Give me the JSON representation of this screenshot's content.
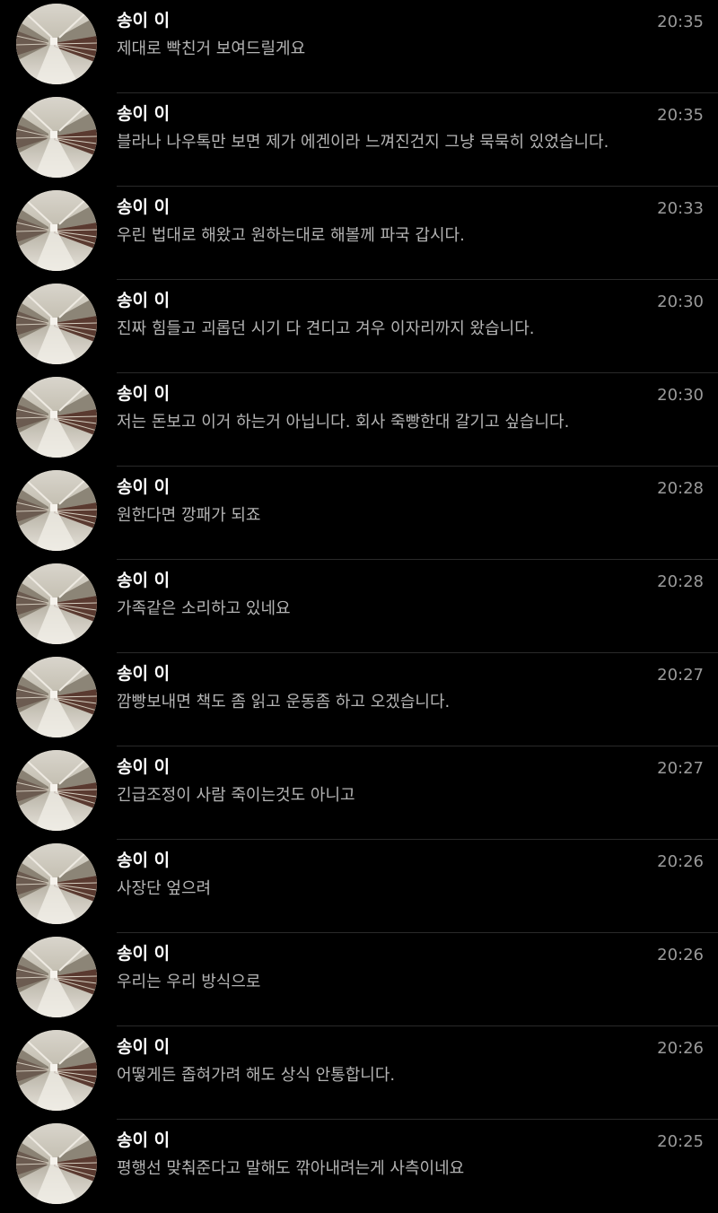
{
  "colors": {
    "background": "#000000",
    "name": "#ffffff",
    "message": "#b4b4b4",
    "time": "#9a9a9a",
    "divider": "#2a2a2a"
  },
  "messages": [
    {
      "sender": "송이 이",
      "time": "20:35",
      "text": "제대로 빡친거 보여드릴게요"
    },
    {
      "sender": "송이 이",
      "time": "20:35",
      "text": "블라나 나우톡만 보면 제가 에겐이라 느껴진건지 그냥 묵묵히 있었습니다."
    },
    {
      "sender": "송이 이",
      "time": "20:33",
      "text": "우린 법대로 해왔고 원하는대로 해볼께 파국 갑시다."
    },
    {
      "sender": "송이 이",
      "time": "20:30",
      "text": "진짜 힘들고 괴롭던 시기 다 견디고 겨우 이자리까지 왔습니다."
    },
    {
      "sender": "송이 이",
      "time": "20:30",
      "text": "저는 돈보고 이거 하는거 아닙니다. 회사 죽빵한대 갈기고 싶습니다."
    },
    {
      "sender": "송이 이",
      "time": "20:28",
      "text": "원한다면 깡패가 되죠"
    },
    {
      "sender": "송이 이",
      "time": "20:28",
      "text": "가족같은 소리하고 있네요"
    },
    {
      "sender": "송이 이",
      "time": "20:27",
      "text": "깜빵보내면 책도 좀 읽고 운동좀 하고 오겠습니다."
    },
    {
      "sender": "송이 이",
      "time": "20:27",
      "text": "긴급조정이 사람 죽이는것도 아니고"
    },
    {
      "sender": "송이 이",
      "time": "20:26",
      "text": "사장단 엎으려"
    },
    {
      "sender": "송이 이",
      "time": "20:26",
      "text": "우리는 우리 방식으로"
    },
    {
      "sender": "송이 이",
      "time": "20:26",
      "text": "어떻게든 좁혀가려 해도 상식 안통합니다."
    },
    {
      "sender": "송이 이",
      "time": "20:25",
      "text": "평행선 맞춰준다고 말해도 깎아내려는게 사측이네요"
    }
  ]
}
